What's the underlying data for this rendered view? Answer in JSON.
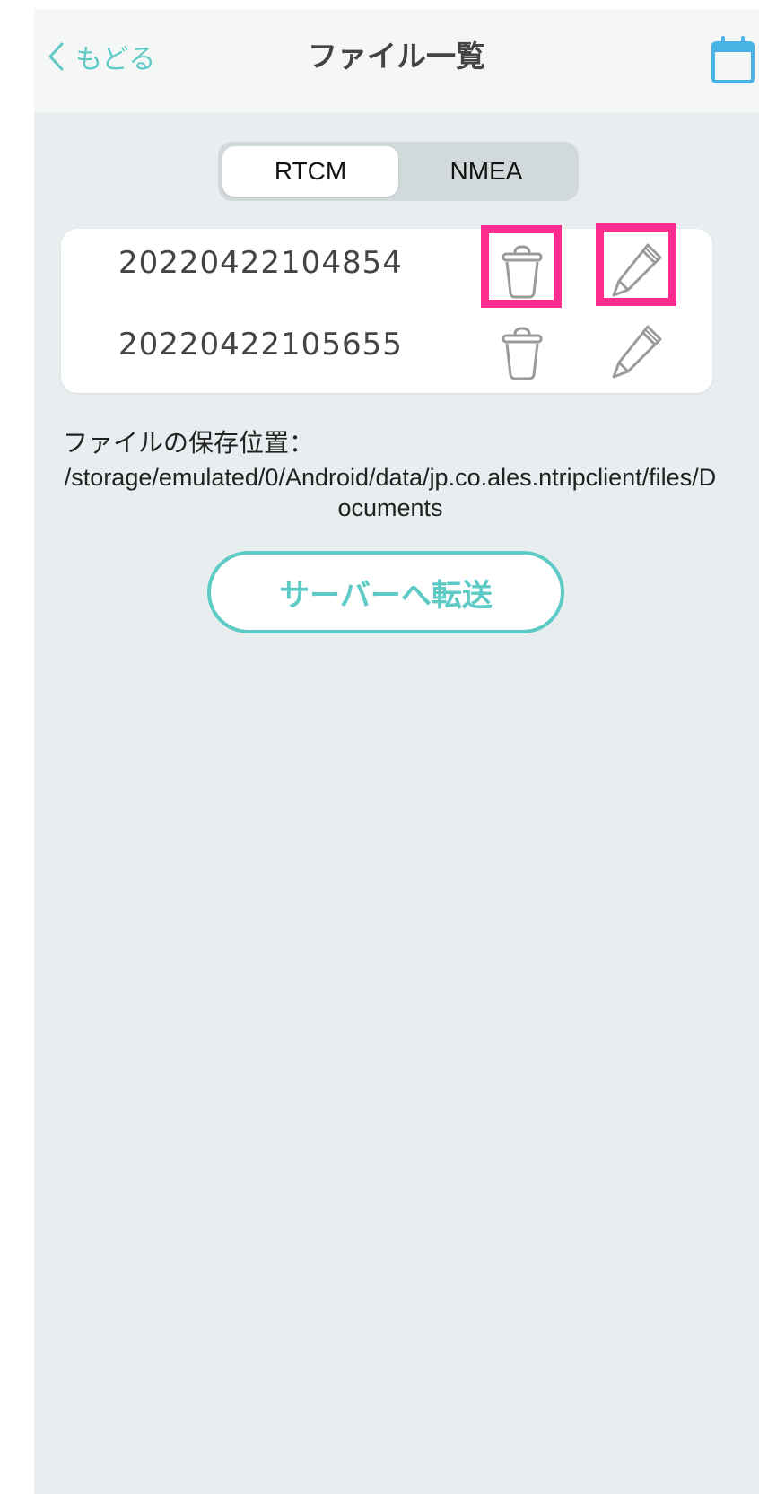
{
  "nav": {
    "back_label": "もどる",
    "title": "ファイル一覧"
  },
  "segment": {
    "options": [
      "RTCM",
      "NMEA"
    ],
    "selected": "RTCM"
  },
  "files": [
    {
      "name": "20220422104854",
      "highlighted": true
    },
    {
      "name": "20220422105655",
      "highlighted": false
    }
  ],
  "storage": {
    "label": "ファイルの保存位置：",
    "path": "/storage/emulated/0/Android/data/jp.co.ales.ntripclient/files/Documents"
  },
  "send_button_label": "サーバーへ転送",
  "icons": {
    "back": "chevron-left-icon",
    "calendar": "calendar-icon",
    "trash": "trash-icon",
    "edit": "pencil-icon"
  },
  "colors": {
    "accent": "#5ecac6",
    "highlight": "#ff2c8f",
    "background": "#e8eeef",
    "calendar": "#4ab3e6"
  }
}
